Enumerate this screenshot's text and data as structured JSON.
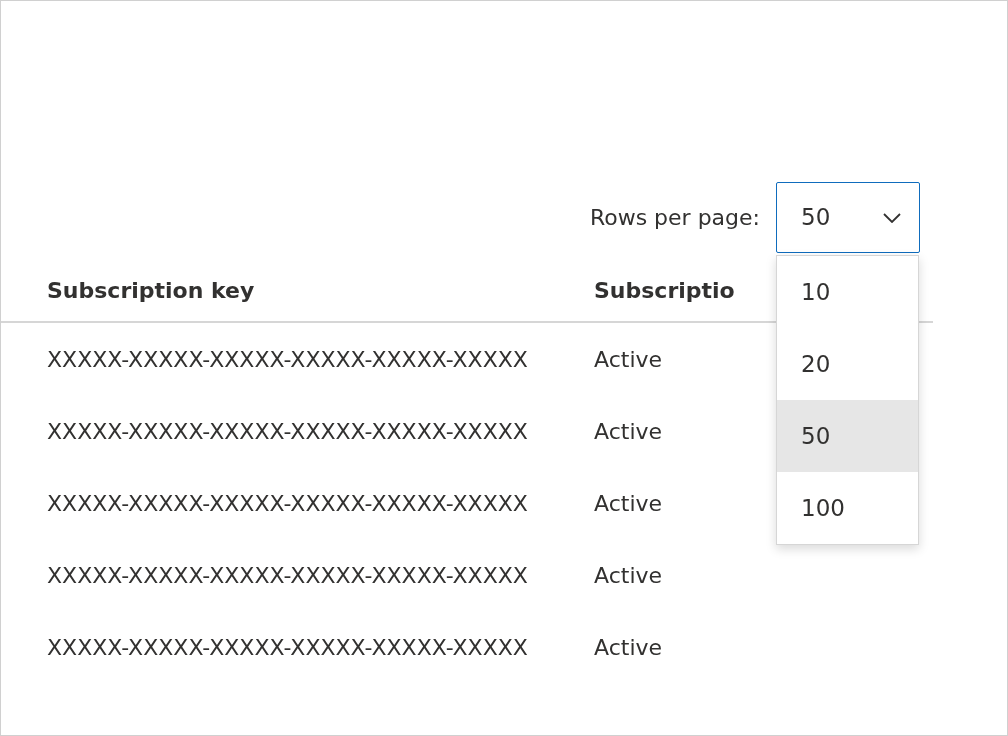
{
  "pager": {
    "label": "Rows per page:",
    "value": "50",
    "expanded": true,
    "options": [
      {
        "label": "10",
        "selected": false
      },
      {
        "label": "20",
        "selected": false
      },
      {
        "label": "50",
        "selected": true
      },
      {
        "label": "100",
        "selected": false
      }
    ]
  },
  "table": {
    "columns": [
      "Subscription key",
      "Subscriptio"
    ],
    "rows": [
      [
        "XXXXX-XXXXX-XXXXX-XXXXX-XXXXX-XXXXX",
        "Active"
      ],
      [
        "XXXXX-XXXXX-XXXXX-XXXXX-XXXXX-XXXXX",
        "Active"
      ],
      [
        "XXXXX-XXXXX-XXXXX-XXXXX-XXXXX-XXXXX",
        "Active"
      ],
      [
        "XXXXX-XXXXX-XXXXX-XXXXX-XXXXX-XXXXX",
        "Active"
      ],
      [
        "XXXXX-XXXXX-XXXXX-XXXXX-XXXXX-XXXXX",
        "Active"
      ]
    ]
  }
}
